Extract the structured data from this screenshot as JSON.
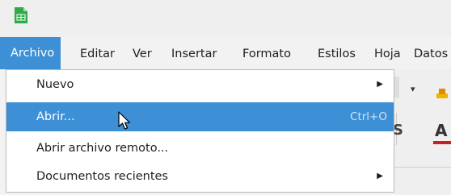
{
  "app": {
    "icon": "calc-spreadsheet-icon"
  },
  "menubar": {
    "items": [
      {
        "label": "Archivo",
        "active": true
      },
      {
        "label": "Editar"
      },
      {
        "label": "Ver"
      },
      {
        "label": "Insertar"
      },
      {
        "label": "Formato"
      },
      {
        "label": "Estilos"
      },
      {
        "label": "Hoja"
      },
      {
        "label": "Datos"
      }
    ]
  },
  "file_menu": {
    "items": [
      {
        "label": "Nuevo",
        "submenu": true
      },
      {
        "label": "Abrir...",
        "shortcut": "Ctrl+O",
        "highlighted": true
      },
      {
        "label": "Abrir archivo remoto..."
      },
      {
        "label": "Documentos recientes",
        "submenu": true
      }
    ]
  },
  "toolbar": {
    "strikethrough_label": "S",
    "font_color_label": "A"
  },
  "colors": {
    "highlight": "#3d8fd6",
    "menu_bg": "#ffffff",
    "bar_bg": "#f2f2f2",
    "app_icon_green": "#2eaa4a"
  }
}
